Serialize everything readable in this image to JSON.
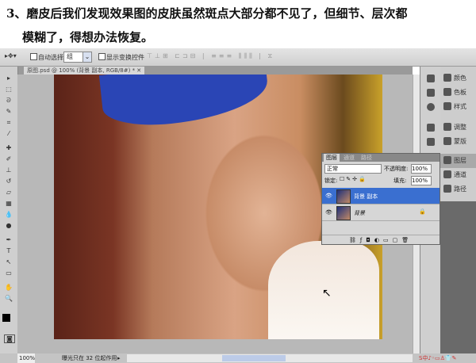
{
  "caption": {
    "line1": "3、磨皮后我们发现效果图的皮肤虽然斑点大部分都不见了，但细节、层次都",
    "line2": "模糊了，得想办法恢复。"
  },
  "options_bar": {
    "auto_select_label": "自动选择:",
    "auto_select_value": "组",
    "show_transform_label": "显示变换控件"
  },
  "document_tab": "原图.psd @ 100% (背景 副本, RGB/8#) *",
  "tools": [
    "move",
    "marquee",
    "lasso",
    "quick-select",
    "crop",
    "eyedropper",
    "healing",
    "brush",
    "stamp",
    "history-brush",
    "eraser",
    "gradient",
    "blur",
    "dodge",
    "pen",
    "type",
    "path-select",
    "shape",
    "hand",
    "zoom"
  ],
  "dock_icons": [
    "color",
    "swatches",
    "styles",
    "adjustments",
    "masks",
    "layers",
    "channels",
    "paths"
  ],
  "dock_labels": [
    "颜色",
    "色板",
    "样式",
    "调整",
    "蒙版",
    "图层",
    "通道",
    "路径"
  ],
  "layers_panel": {
    "tabs": [
      "图层",
      "通道",
      "路径"
    ],
    "blend_mode": "正常",
    "opacity_label": "不透明度:",
    "opacity": "100%",
    "lock_label": "锁定:",
    "fill_label": "填充:",
    "fill": "100%",
    "layers": [
      {
        "name": "背景 副本",
        "selected": true
      },
      {
        "name": "背景",
        "selected": false,
        "locked": true
      }
    ],
    "footer_icons": [
      "link",
      "fx",
      "mask",
      "adjustment",
      "group",
      "new-layer",
      "delete"
    ]
  },
  "status_bar": {
    "zoom": "100%",
    "info": "曝光只在 32 位起作用"
  },
  "colors": {
    "accent": "#3a6fd0",
    "band": "#2a45b5"
  }
}
